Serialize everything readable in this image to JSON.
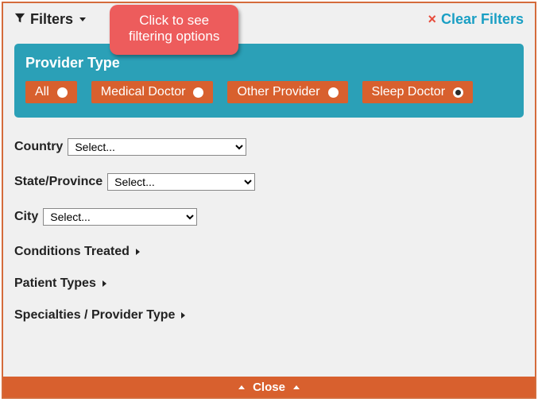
{
  "header": {
    "filters_label": "Filters",
    "clear_icon": "×",
    "clear_label": "Clear Filters"
  },
  "callout": {
    "line1": "Click to see",
    "line2": "filtering options"
  },
  "provider_type": {
    "title": "Provider Type",
    "options": {
      "all": "All",
      "medical_doctor": "Medical Doctor",
      "other_provider": "Other Provider",
      "sleep_doctor": "Sleep Doctor"
    },
    "selected": "sleep_doctor"
  },
  "selects": {
    "country": {
      "label": "Country",
      "value": "Select..."
    },
    "state": {
      "label": "State/Province",
      "value": "Select..."
    },
    "city": {
      "label": "City",
      "value": "Select..."
    }
  },
  "expanders": {
    "conditions": "Conditions Treated",
    "patient_types": "Patient Types",
    "specialties": "Specialties / Provider Type"
  },
  "close_label": "Close"
}
